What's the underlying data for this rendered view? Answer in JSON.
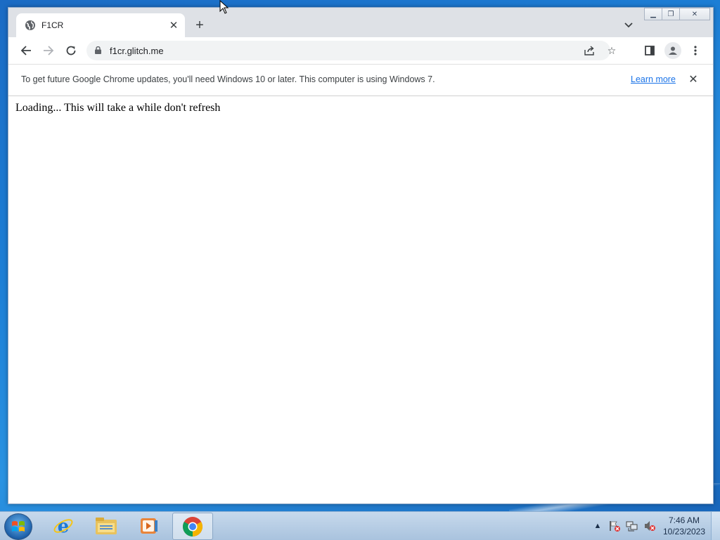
{
  "browser": {
    "tab": {
      "title": "F1CR"
    },
    "address": {
      "url": "f1cr.glitch.me"
    },
    "infobar": {
      "message": "To get future Google Chrome updates, you'll need Windows 10 or later. This computer is using Windows 7.",
      "link_label": "Learn more"
    },
    "page": {
      "text": "Loading... This will take a while don't refresh"
    }
  },
  "taskbar": {
    "apps": [
      "internet-explorer",
      "windows-explorer",
      "media-player",
      "chrome"
    ],
    "active_app": "chrome",
    "clock": {
      "time": "7:46 AM",
      "date": "10/23/2023"
    }
  },
  "colors": {
    "link": "#1a73e8",
    "tabstrip": "#dee1e6",
    "omnibox": "#f1f3f4"
  }
}
